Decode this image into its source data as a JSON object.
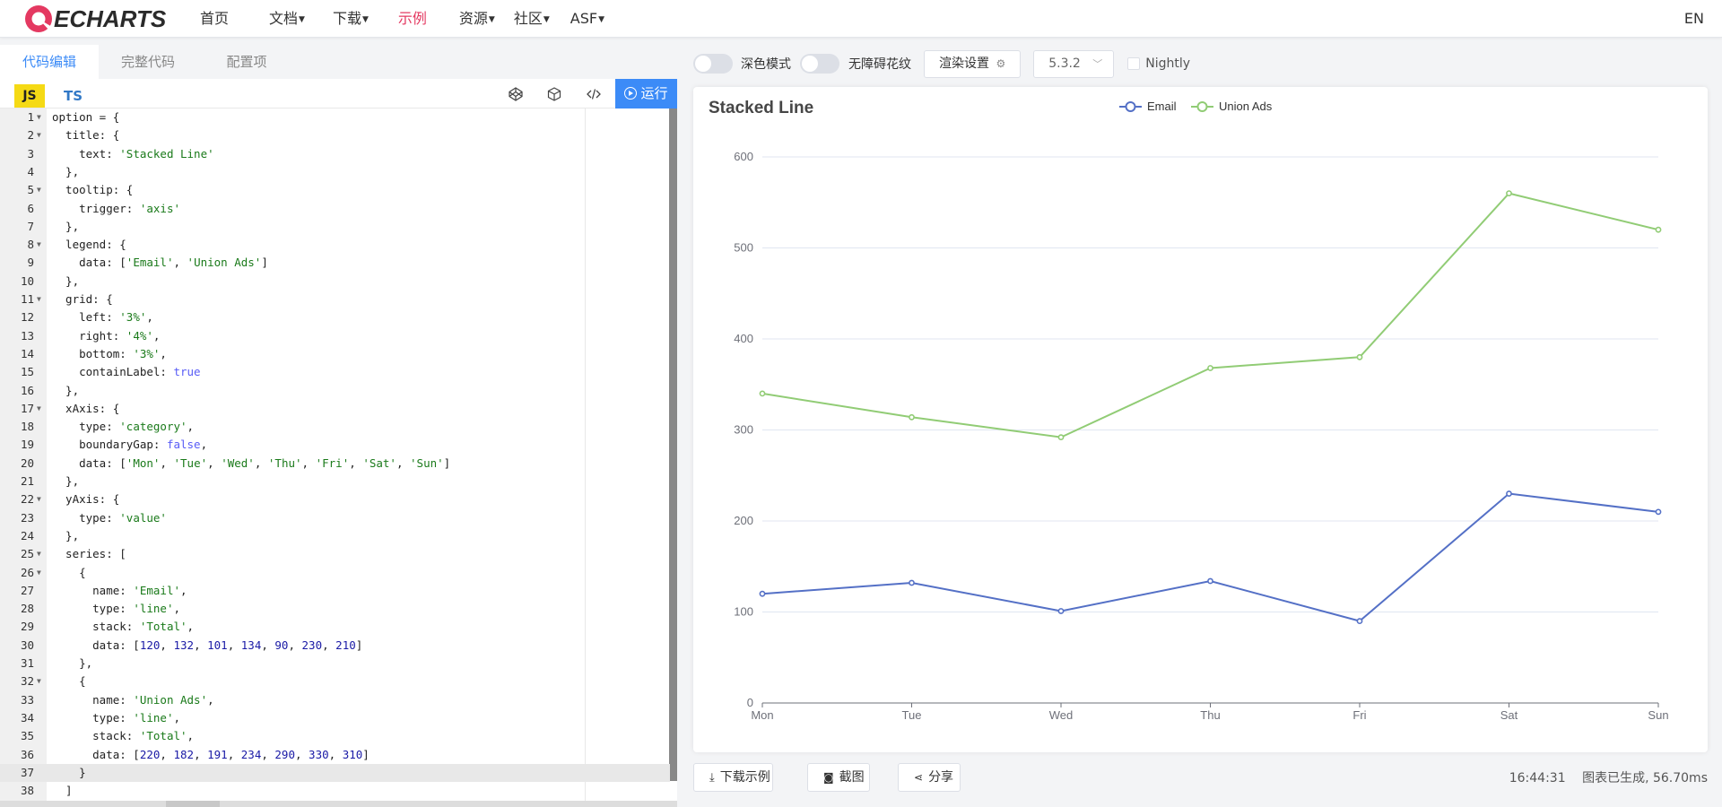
{
  "nav": {
    "logo_text": "ECHARTS",
    "items": [
      {
        "label": "首页",
        "dropdown": false
      },
      {
        "label": "文档",
        "dropdown": true
      },
      {
        "label": "下载",
        "dropdown": true
      },
      {
        "label": "示例",
        "dropdown": false,
        "active": true
      },
      {
        "label": "资源",
        "dropdown": true
      },
      {
        "label": "社区",
        "dropdown": true
      },
      {
        "label": "ASF",
        "dropdown": true
      }
    ],
    "lang": "EN"
  },
  "editor_tabs": [
    "代码编辑",
    "完整代码",
    "配置项"
  ],
  "editor_toolbar": {
    "js": "JS",
    "ts": "TS",
    "run": "运行",
    "icons": [
      "codepen-icon",
      "codesandbox-icon",
      "code-icon"
    ]
  },
  "code_lines": [
    {
      "n": "1",
      "fold": true,
      "html": "<span class=\"k\">option = {</span>"
    },
    {
      "n": "2",
      "fold": true,
      "html": "  title: {"
    },
    {
      "n": "3",
      "fold": false,
      "html": "    text: <span class=\"s\">'Stacked Line'</span>"
    },
    {
      "n": "4",
      "fold": false,
      "html": "  },"
    },
    {
      "n": "5",
      "fold": true,
      "html": "  tooltip: {"
    },
    {
      "n": "6",
      "fold": false,
      "html": "    trigger: <span class=\"s\">'axis'</span>"
    },
    {
      "n": "7",
      "fold": false,
      "html": "  },"
    },
    {
      "n": "8",
      "fold": true,
      "html": "  legend: {"
    },
    {
      "n": "9",
      "fold": false,
      "html": "    data: [<span class=\"s\">'Email'</span>, <span class=\"s\">'Union Ads'</span>]"
    },
    {
      "n": "10",
      "fold": false,
      "html": "  },"
    },
    {
      "n": "11",
      "fold": true,
      "html": "  grid: {"
    },
    {
      "n": "12",
      "fold": false,
      "html": "    left: <span class=\"s\">'3%'</span>,"
    },
    {
      "n": "13",
      "fold": false,
      "html": "    right: <span class=\"s\">'4%'</span>,"
    },
    {
      "n": "14",
      "fold": false,
      "html": "    bottom: <span class=\"s\">'3%'</span>,"
    },
    {
      "n": "15",
      "fold": false,
      "html": "    containLabel: <span class=\"b\">true</span>"
    },
    {
      "n": "16",
      "fold": false,
      "html": "  },"
    },
    {
      "n": "17",
      "fold": true,
      "html": "  xAxis: {"
    },
    {
      "n": "18",
      "fold": false,
      "html": "    type: <span class=\"s\">'category'</span>,"
    },
    {
      "n": "19",
      "fold": false,
      "html": "    boundaryGap: <span class=\"b\">false</span>,"
    },
    {
      "n": "20",
      "fold": false,
      "html": "    data: [<span class=\"s\">'Mon'</span>, <span class=\"s\">'Tue'</span>, <span class=\"s\">'Wed'</span>, <span class=\"s\">'Thu'</span>, <span class=\"s\">'Fri'</span>, <span class=\"s\">'Sat'</span>, <span class=\"s\">'Sun'</span>]"
    },
    {
      "n": "21",
      "fold": false,
      "html": "  },"
    },
    {
      "n": "22",
      "fold": true,
      "html": "  yAxis: {"
    },
    {
      "n": "23",
      "fold": false,
      "html": "    type: <span class=\"s\">'value'</span>"
    },
    {
      "n": "24",
      "fold": false,
      "html": "  },"
    },
    {
      "n": "25",
      "fold": true,
      "html": "  series: ["
    },
    {
      "n": "26",
      "fold": true,
      "html": "    {"
    },
    {
      "n": "27",
      "fold": false,
      "html": "      name: <span class=\"s\">'Email'</span>,"
    },
    {
      "n": "28",
      "fold": false,
      "html": "      type: <span class=\"s\">'line'</span>,"
    },
    {
      "n": "29",
      "fold": false,
      "html": "      stack: <span class=\"s\">'Total'</span>,"
    },
    {
      "n": "30",
      "fold": false,
      "html": "      data: [<span class=\"n\">120</span>, <span class=\"n\">132</span>, <span class=\"n\">101</span>, <span class=\"n\">134</span>, <span class=\"n\">90</span>, <span class=\"n\">230</span>, <span class=\"n\">210</span>]"
    },
    {
      "n": "31",
      "fold": false,
      "html": "    },"
    },
    {
      "n": "32",
      "fold": true,
      "html": "    {"
    },
    {
      "n": "33",
      "fold": false,
      "html": "      name: <span class=\"s\">'Union Ads'</span>,"
    },
    {
      "n": "34",
      "fold": false,
      "html": "      type: <span class=\"s\">'line'</span>,"
    },
    {
      "n": "35",
      "fold": false,
      "html": "      stack: <span class=\"s\">'Total'</span>,"
    },
    {
      "n": "36",
      "fold": false,
      "html": "      data: [<span class=\"n\">220</span>, <span class=\"n\">182</span>, <span class=\"n\">191</span>, <span class=\"n\">234</span>, <span class=\"n\">290</span>, <span class=\"n\">330</span>, <span class=\"n\">310</span>]"
    },
    {
      "n": "37",
      "fold": false,
      "current": true,
      "html": "    }"
    },
    {
      "n": "38",
      "fold": false,
      "html": "  ]"
    }
  ],
  "right_toolbar": {
    "dark_mode": "深色模式",
    "aria": "无障碍花纹",
    "render_settings": "渲染设置",
    "version": "5.3.2",
    "nightly": "Nightly"
  },
  "chart_data": {
    "type": "line",
    "title": "Stacked Line",
    "categories": [
      "Mon",
      "Tue",
      "Wed",
      "Thu",
      "Fri",
      "Sat",
      "Sun"
    ],
    "series": [
      {
        "name": "Email",
        "values": [
          120,
          132,
          101,
          134,
          90,
          230,
          210
        ],
        "color": "#5470c6"
      },
      {
        "name": "Union Ads",
        "values": [
          340,
          314,
          292,
          368,
          380,
          560,
          520
        ],
        "color": "#91cc75"
      }
    ],
    "ylim": [
      0,
      600
    ],
    "yticks": [
      0,
      100,
      200,
      300,
      400,
      500,
      600
    ],
    "grid": true,
    "legend": "top-center"
  },
  "bottom": {
    "download": "下载示例",
    "screenshot": "截图",
    "share": "分享",
    "time": "16:44:31",
    "status": "图表已生成, 56.70ms"
  }
}
